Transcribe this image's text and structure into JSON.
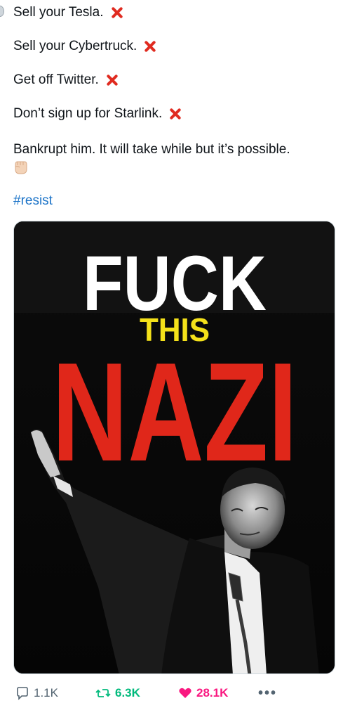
{
  "post": {
    "lines": [
      {
        "text": "Sell your Tesla.",
        "emoji": "cross-mark-icon"
      },
      {
        "text": "Sell your Cybertruck.",
        "emoji": "cross-mark-icon"
      },
      {
        "text": "Get off Twitter.",
        "emoji": "cross-mark-icon"
      },
      {
        "text": "Don’t sign up for Starlink.",
        "emoji": "cross-mark-icon"
      },
      {
        "text": "Bankrupt him. It will take while but it’s possible.",
        "emoji": "raised-fist-icon"
      }
    ],
    "hashtag": "#resist"
  },
  "media": {
    "poster_line1": "FUCK",
    "poster_line2": "THIS",
    "poster_line3": "NAZI",
    "colors": {
      "white": "#ffffff",
      "yellow": "#f4e11a",
      "red": "#e0271a",
      "background": "#0a0a0a"
    }
  },
  "actions": {
    "reply_count": "1.1K",
    "retweet_count": "6.3K",
    "like_count": "28.1K",
    "more_label": "•••"
  },
  "colors": {
    "hashtag": "#1d74c8",
    "retweet_active": "#00ba7c",
    "like_active": "#f91880",
    "cross_mark": "#e02b20"
  }
}
